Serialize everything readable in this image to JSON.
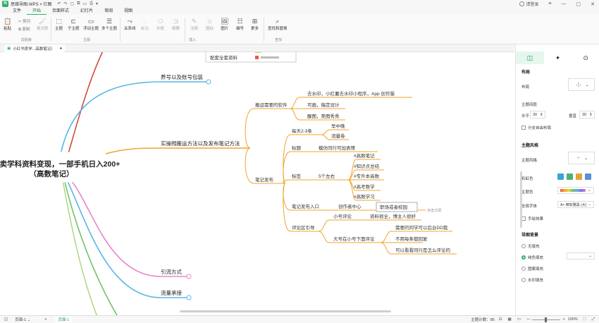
{
  "app": {
    "logo": "N",
    "title": "思维导图-WPS × 亿图",
    "quick": [
      "↶",
      "↷",
      "▢",
      "⧉",
      "▭",
      "⎙",
      "▾"
    ],
    "login": "请登录",
    "win": [
      "≡",
      "—",
      "▢",
      "✕"
    ]
  },
  "menu": [
    "文件",
    "开始",
    "页面样式",
    "幻灯片",
    "审阅",
    "视图"
  ],
  "ribbon": {
    "paste": "粘贴",
    "cut": "剪切",
    "copy": "复制",
    "format_painter": "格式刷",
    "main_topic": "主题",
    "sub_topic": "子主题",
    "float_topic": "浮动主题",
    "multi_topic": "多个主题",
    "relation": "关系线",
    "label": "标注",
    "outline": "外框",
    "summary": "概要",
    "note": "注释",
    "icon": "图标",
    "image": "图片",
    "number": "编号",
    "more": "更多",
    "find_replace": "查找和替换",
    "groups": {
      "clipboard": "剪贴板",
      "topic": "主题",
      "insert": "插入",
      "find": "查找"
    }
  },
  "doc_tab": "小红书卖学...高数笔记）",
  "right_top": "图标",
  "mindmap": {
    "root_line1": "卖学科资料变现，一部手机日入200+",
    "root_line2": "（高数笔记）",
    "top_node": "配套全套资料",
    "branch_brand": "养号以及账号包装",
    "branch_main": "实操拇搬运方法以及发布笔记方法",
    "branch_traffic": "引流方式",
    "branch_funnel": "流量承接",
    "tools": "搬运需要的软件",
    "tool1": "去水印，小红薯去水印小程序，App  创作猫",
    "tool2": "可画，稿定设计",
    "tool3": "醒图，美图秀秀",
    "publish": "笔记发布",
    "daily": "每天2-3条",
    "morning": "早中晚",
    "flow_coupon": "流量卷",
    "title_n": "标题",
    "title_tip": "模仿同行可加表情",
    "tags": "标签",
    "tags_n": "5个左右",
    "tag1": "#高数笔记",
    "tag2": "#知识点总结",
    "tag3": "#专升本高数",
    "tag4": "#高考数学",
    "tag5": "#高数学习",
    "entry": "笔记发布入口",
    "creator": "创作者中心",
    "campus": "职场或者校园",
    "click_sub": "点击订阅",
    "comment": "评论区引导",
    "small_c": "小号评论",
    "small_c1": "资料很全，博主人很好",
    "big_c": "大号在小号下面评论",
    "big_c1": "需要的同学可以后台DD我",
    "big_c2": "不用每条都回复",
    "big_c3": "可以看看同行是怎么评论的"
  },
  "panel": {
    "tabs": [
      "◫",
      "✦",
      "⊙"
    ],
    "layout_h": "布局",
    "layout_l": "布局",
    "spacing_l": "主题间距",
    "h_l": "水平",
    "h_v": "30",
    "v_l": "垂直",
    "v_v": "30",
    "free_l": "分支自由布局",
    "style_h": "主题风格",
    "style_l": "主题风格",
    "color_l": "彩虹色",
    "theme_l": "主题色",
    "font_l": "全局字体",
    "font_v": "A+ 微软雅黑 (大)",
    "hand_l": "手绘效果",
    "bg_h": "导图背景",
    "bg1": "无填充",
    "bg2": "纯色填充",
    "bg3": "图案填充",
    "bg4": "水印填充",
    "colors": {
      "green": "#2fb36b",
      "root_blue": "#58b7e8",
      "orange": "#f0a42b",
      "pink": "#e886c8",
      "red": "#d24b3b"
    }
  },
  "status": {
    "page_l": "页面-1",
    "page_tab": "页面-1",
    "count": "主题计数：85",
    "zoom": "100%"
  }
}
